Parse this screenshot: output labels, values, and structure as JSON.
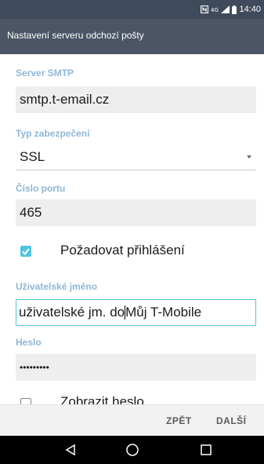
{
  "status": {
    "time": "14:40"
  },
  "appbar": {
    "title": "Nastavení serveru odchozí pošty"
  },
  "form": {
    "server": {
      "label": "Server SMTP",
      "value": "smtp.t-email.cz"
    },
    "security": {
      "label": "Typ zabezpečení",
      "value": "SSL"
    },
    "port": {
      "label": "Číslo portu",
      "value": "465"
    },
    "require_login": {
      "label": "Požadovat přihlášení",
      "checked": true
    },
    "username": {
      "label": "Uživatelské jméno",
      "value_before": "uživatelské jm. do ",
      "value_after": "Můj T-Mobile"
    },
    "password": {
      "label": "Heslo",
      "value": "•••••••••"
    },
    "show_password": {
      "label": "Zobrazit heslo",
      "checked": false
    }
  },
  "actions": {
    "back": "ZPĚT",
    "next": "DALŠÍ"
  },
  "colors": {
    "accent": "#4fc3e0",
    "label": "#8fb7d6",
    "appbar": "#4b5566",
    "statusbar": "#3f4a5c"
  }
}
